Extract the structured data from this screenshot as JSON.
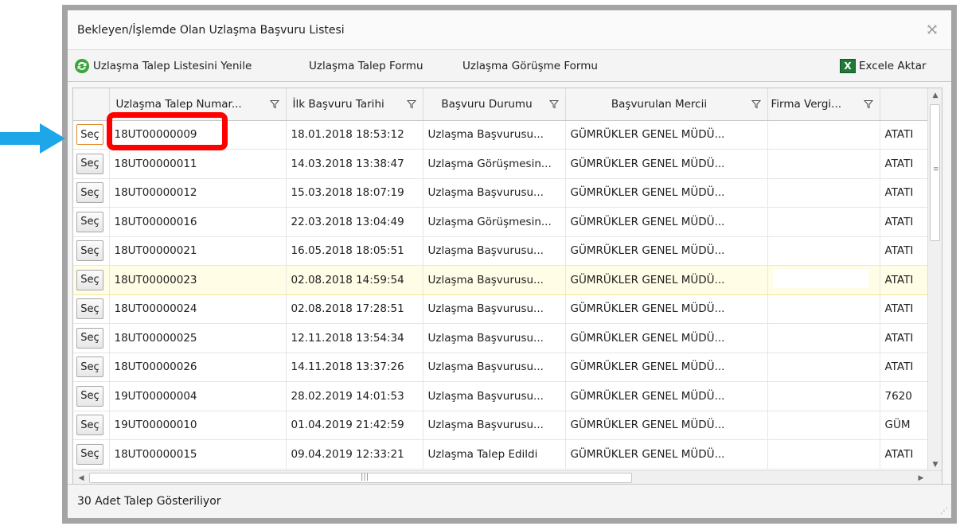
{
  "window": {
    "title": "Bekleyen/İşlemde Olan Uzlaşma Başvuru Listesi",
    "close_icon": "close-icon"
  },
  "toolbar": {
    "refresh_label": "Uzlaşma Talep Listesini Yenile",
    "request_form_label": "Uzlaşma Talep Formu",
    "meeting_form_label": "Uzlaşma Görüşme Formu",
    "export_label": "Excele Aktar",
    "refresh_icon": "refresh-icon",
    "excel_icon": "excel-icon"
  },
  "grid": {
    "columns": [
      "Uzlaşma Talep Numar...",
      "İlk Başvuru Tarihi",
      "Başvuru Durumu",
      "Başvurulan Mercii",
      "Firma Vergi..."
    ],
    "select_label": "Seç",
    "rows": [
      {
        "no": "18UT00000009",
        "date": "18.01.2018 18:53:12",
        "status": "Uzlaşma Başvurusu...",
        "office": "GÜMRÜKLER GENEL MÜDÜ...",
        "extra": "ATATI"
      },
      {
        "no": "18UT00000011",
        "date": "14.03.2018 13:38:47",
        "status": "Uzlaşma Görüşmesin...",
        "office": "GÜMRÜKLER GENEL MÜDÜ...",
        "extra": "ATATI"
      },
      {
        "no": "18UT00000012",
        "date": "15.03.2018 18:07:19",
        "status": "Uzlaşma Başvurusu...",
        "office": "GÜMRÜKLER GENEL MÜDÜ...",
        "extra": "ATATI"
      },
      {
        "no": "18UT00000016",
        "date": "22.03.2018 13:04:49",
        "status": "Uzlaşma Görüşmesin...",
        "office": "GÜMRÜKLER GENEL MÜDÜ...",
        "extra": "ATATI"
      },
      {
        "no": "18UT00000021",
        "date": "16.05.2018 18:05:51",
        "status": "Uzlaşma Başvurusu...",
        "office": "GÜMRÜKLER GENEL MÜDÜ...",
        "extra": "ATATI"
      },
      {
        "no": "18UT00000023",
        "date": "02.08.2018 14:59:54",
        "status": "Uzlaşma Başvurusu...",
        "office": "GÜMRÜKLER GENEL MÜDÜ...",
        "extra": "ATATI"
      },
      {
        "no": "18UT00000024",
        "date": "02.08.2018 17:28:51",
        "status": "Uzlaşma Başvurusu...",
        "office": "GÜMRÜKLER GENEL MÜDÜ...",
        "extra": "ATATI"
      },
      {
        "no": "18UT00000025",
        "date": "12.11.2018 13:54:34",
        "status": "Uzlaşma Başvurusu...",
        "office": "GÜMRÜKLER GENEL MÜDÜ...",
        "extra": "ATATI"
      },
      {
        "no": "18UT00000026",
        "date": "14.11.2018 13:37:26",
        "status": "Uzlaşma Başvurusu...",
        "office": "GÜMRÜKLER GENEL MÜDÜ...",
        "extra": "ATATI"
      },
      {
        "no": "19UT00000004",
        "date": "28.02.2019 14:01:53",
        "status": "Uzlaşma Başvurusu...",
        "office": "GÜMRÜKLER GENEL MÜDÜ...",
        "extra": "7620"
      },
      {
        "no": "19UT00000010",
        "date": "01.04.2019 21:42:59",
        "status": "Uzlaşma Başvurusu...",
        "office": "GÜMRÜKLER GENEL MÜDÜ...",
        "extra": "GÜM"
      },
      {
        "no": "18UT00000015",
        "date": "09.04.2019 12:33:21",
        "status": "Uzlaşma Talep Edildi",
        "office": "GÜMRÜKLER GENEL MÜDÜ...",
        "extra": "ATATI"
      }
    ]
  },
  "status": {
    "text": "30 Adet Talep Gösteriliyor"
  },
  "annotations": {
    "highlight_color": "#ff0000",
    "arrow_color": "#1ea7e8"
  }
}
